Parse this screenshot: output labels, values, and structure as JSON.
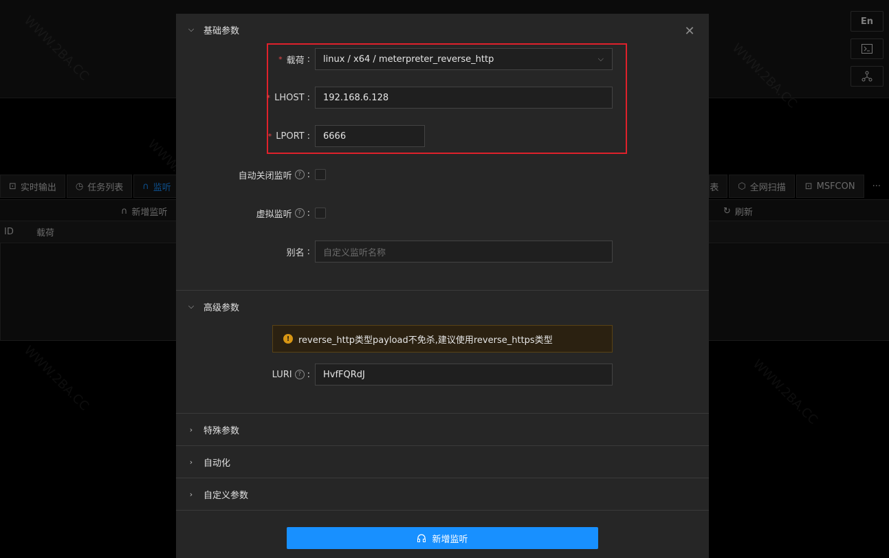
{
  "background": {
    "tabs": [
      {
        "icon": "terminal-output-icon",
        "label": "实时输出"
      },
      {
        "icon": "clock-icon",
        "label": "任务列表"
      },
      {
        "icon": "headphones-icon",
        "label": "监听"
      }
    ],
    "tabs_right": [
      {
        "label": "表"
      },
      {
        "icon": "scan-icon",
        "label": "全网扫描"
      },
      {
        "icon": "console-icon",
        "label": "MSFCON"
      },
      {
        "label": "···"
      }
    ],
    "toolbar": {
      "add_listener": "新增监听",
      "refresh": "刷新"
    },
    "table_headers": [
      "ID",
      "载荷"
    ],
    "side_buttons": {
      "lang": "En"
    }
  },
  "modal": {
    "sections": {
      "basic": "基础参数",
      "advanced": "高级参数",
      "special": "特殊参数",
      "automation": "自动化",
      "custom": "自定义参数"
    },
    "fields": {
      "payload": {
        "label": "载荷",
        "value": "linux / x64 / meterpreter_reverse_http"
      },
      "lhost": {
        "label": "LHOST",
        "value": "192.168.6.128"
      },
      "lport": {
        "label": "LPORT",
        "value": "6666"
      },
      "auto_close": {
        "label": "自动关闭监听"
      },
      "virtual": {
        "label": "虚拟监听"
      },
      "alias": {
        "label": "别名",
        "placeholder": "自定义监听名称"
      },
      "luri": {
        "label": "LURI",
        "value": "HvfFQRdJ"
      }
    },
    "alert": "reverse_http类型payload不免杀,建议使用reverse_https类型",
    "submit": "新增监听"
  },
  "colors": {
    "accent": "#1890ff",
    "highlight_box": "#e0212b",
    "warning": "#d89614"
  }
}
